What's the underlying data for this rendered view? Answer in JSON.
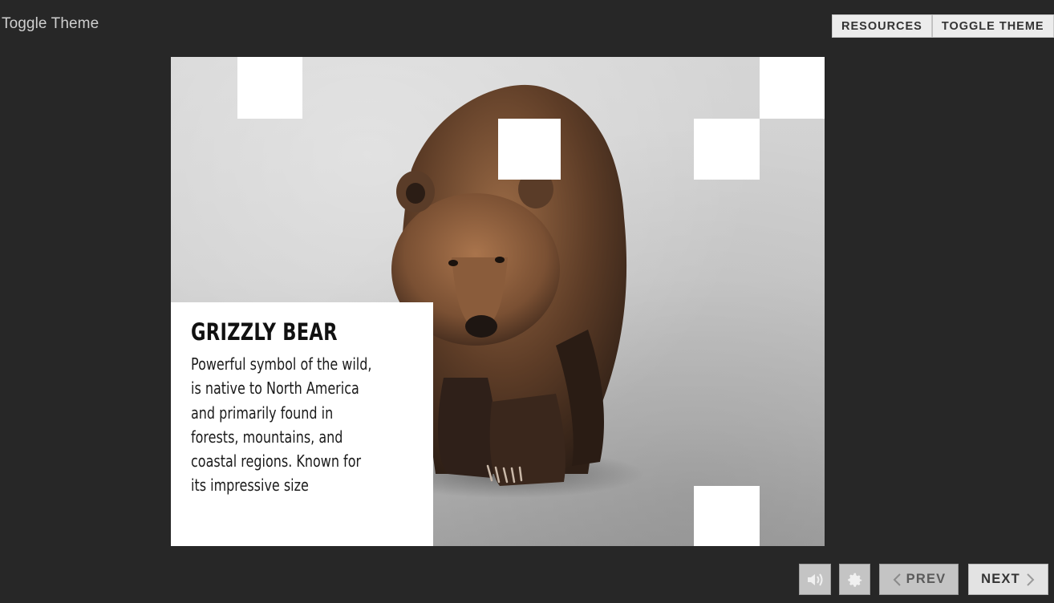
{
  "header": {
    "title": "Toggle Theme",
    "buttons": {
      "resources": "RESOURCES",
      "toggle_theme": "TOGGLE THEME"
    }
  },
  "slide": {
    "title": "GRIZZLY BEAR",
    "description": "Powerful symbol of the wild, is native to North America and primarily found in forests, mountains, and coastal regions. Known for its impressive size"
  },
  "controls": {
    "audio_icon": "speaker-icon",
    "settings_icon": "gear-icon",
    "prev_label": "PREV",
    "next_label": "NEXT",
    "prev_disabled": true
  },
  "colors": {
    "background": "#272727",
    "button": "#ececec",
    "card": "#ffffff"
  }
}
